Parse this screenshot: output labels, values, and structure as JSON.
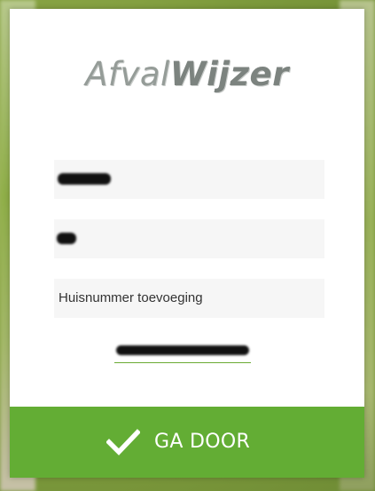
{
  "app": {
    "logo_light": "Afval",
    "logo_bold": "Wijzer"
  },
  "form": {
    "postcode_value": "",
    "house_number_value": "",
    "addition_placeholder": "Huisnummer toevoeging",
    "address_result": "",
    "submit_label": "GA DOOR"
  },
  "colors": {
    "accent": "#63ad34",
    "field_bg": "#f6f6f6",
    "logo": "#8a918c"
  },
  "icons": {
    "submit": "checkmark-icon"
  }
}
